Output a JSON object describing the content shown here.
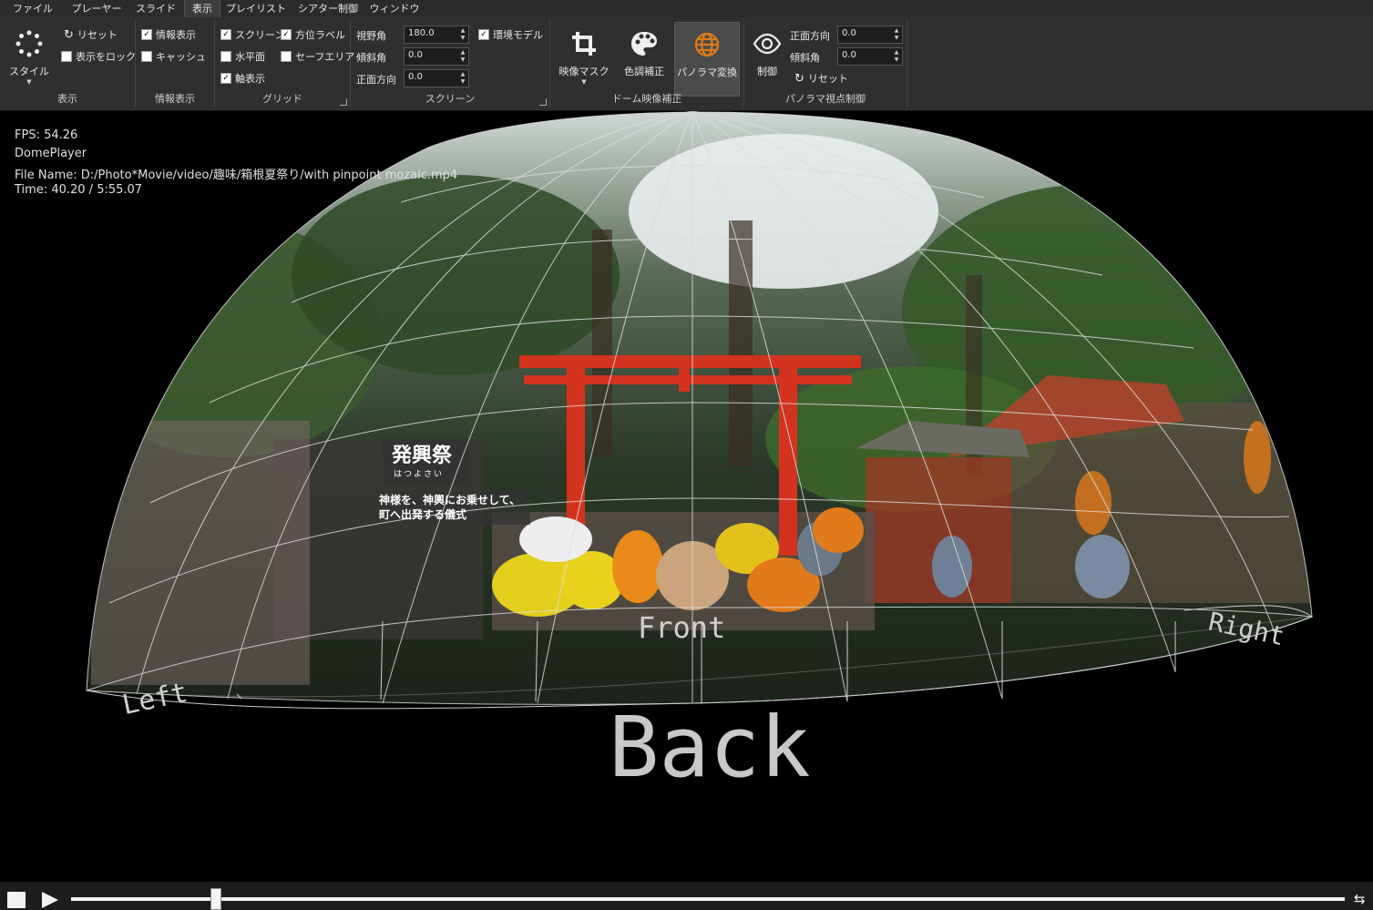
{
  "menu": [
    "ファイル",
    "プレーヤー",
    "スライド",
    "表示",
    "プレイリスト",
    "シアター制御",
    "ウィンドウ"
  ],
  "active_menu": "表示",
  "ribbon": {
    "display": {
      "title": "表示",
      "style_label": "スタイル",
      "reset_label": "リセット",
      "lock_label": "表示をロック",
      "lock_checked": false
    },
    "info": {
      "title": "情報表示",
      "info_label": "情報表示",
      "info_checked": true,
      "cache_label": "キャッシュ",
      "cache_checked": false
    },
    "grid": {
      "title": "グリッド",
      "screen_label": "スクリーン",
      "screen_checked": true,
      "horizon_label": "水平面",
      "horizon_checked": false,
      "axis_label": "軸表示",
      "axis_checked": true,
      "direction_label": "方位ラベル",
      "direction_checked": true,
      "safe_label": "セーフエリア",
      "safe_checked": false
    },
    "screen": {
      "title": "スクリーン",
      "fov_label": "視野角",
      "fov_value": "180.0",
      "tilt_label": "傾斜角",
      "tilt_value": "0.0",
      "front_label": "正面方向",
      "front_value": "0.0",
      "env_label": "環境モデル",
      "env_checked": true
    },
    "dome": {
      "title": "ドーム映像補正",
      "mask_label": "映像マスク",
      "color_label": "色調補正",
      "pano_label": "パノラマ変換"
    },
    "pano": {
      "title": "パノラマ視点制御",
      "control_label": "制御",
      "front_label": "正面方向",
      "front_value": "0.0",
      "tilt_label": "傾斜角",
      "tilt_value": "0.0",
      "reset_label": "リセット"
    }
  },
  "overlay": {
    "fps": "FPS: 54.26",
    "app": "DomePlayer",
    "file": "File Name: D:/Photo*Movie/video/趣味/箱根夏祭り/with pinpoint mozaic.mp4",
    "time": "Time: 40.20 / 5:55.07"
  },
  "caption": {
    "title": "発興祭",
    "ruby": "はつよさい",
    "line1": "神様を、神輿にお乗せして、",
    "line2": "町へ出発する儀式"
  },
  "labels": {
    "front": "Front",
    "right": "Right",
    "left": "Left",
    "back": "Back"
  },
  "playback": {
    "progress": 0.113
  },
  "colors": {
    "accent": "#e07a1a",
    "torii": "#d2331f"
  }
}
